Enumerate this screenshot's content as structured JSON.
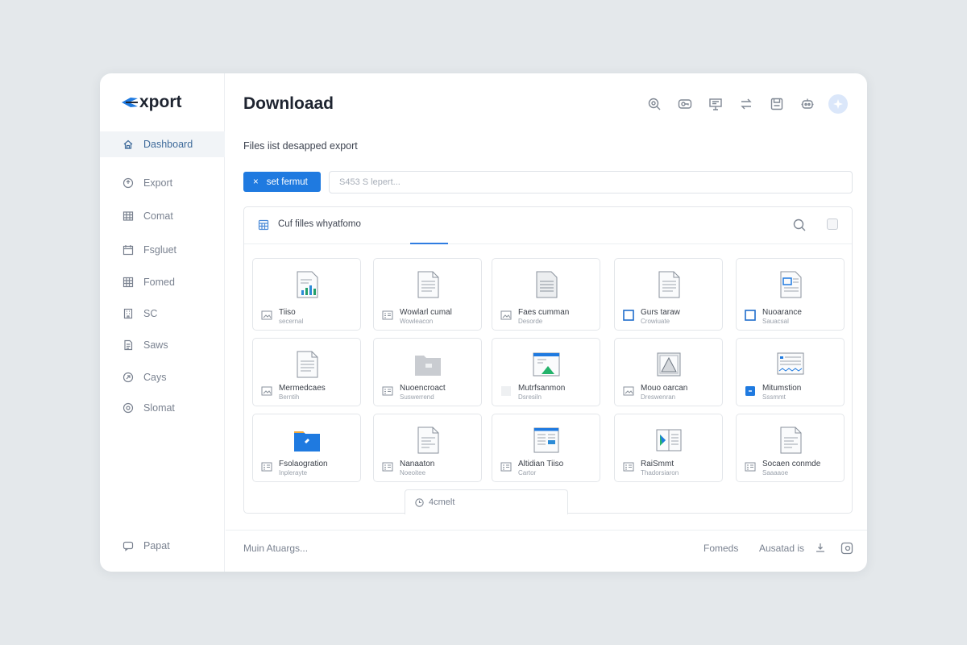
{
  "app": {
    "logo_text": "xport"
  },
  "sidebar": {
    "items": [
      {
        "label": "Dashboard",
        "icon": "home-icon",
        "active": true
      },
      {
        "label": "Export",
        "icon": "export-icon"
      },
      {
        "label": "Comat",
        "icon": "table-icon"
      },
      {
        "label": "Fsgluet",
        "icon": "calendar-icon"
      },
      {
        "label": "Fomed",
        "icon": "grid-icon"
      },
      {
        "label": "SC",
        "icon": "building-icon"
      },
      {
        "label": "Saws",
        "icon": "document-icon"
      },
      {
        "label": "Cays",
        "icon": "tag-icon"
      },
      {
        "label": "Slomat",
        "icon": "settings-icon"
      }
    ],
    "bottom_item": {
      "label": "Papat",
      "icon": "chat-icon"
    }
  },
  "header": {
    "title": "Downloaad",
    "icons": [
      "search-zoom-icon",
      "key-icon",
      "presentation-icon",
      "swap-icon",
      "save-icon",
      "robot-icon",
      "profile-icon"
    ]
  },
  "main": {
    "subtitle": "Files iist desapped export",
    "format_button": {
      "icon": "×",
      "label": "set fermut"
    },
    "search": {
      "placeholder": "S453 S lepert..."
    }
  },
  "panel": {
    "title": "Cuf filles whyatfomo",
    "files": [
      {
        "name": "Tiiso",
        "sub": "secernal"
      },
      {
        "name": "Wowlarl cumal",
        "sub": "Wowleacon"
      },
      {
        "name": "Faes cumman",
        "sub": "Desorde"
      },
      {
        "name": "Gurs taraw",
        "sub": "Crowiuate"
      },
      {
        "name": "Nuoarance",
        "sub": "Sauacsal"
      },
      {
        "name": "Mermedcaes",
        "sub": "Berntih"
      },
      {
        "name": "Nuoencroact",
        "sub": "Suswerrend"
      },
      {
        "name": "Mutrfsanmon",
        "sub": "Dsresiln"
      },
      {
        "name": "Mouo oarcan",
        "sub": "Dreswenran"
      },
      {
        "name": "Mitumstion",
        "sub": "Sssmmt"
      },
      {
        "name": "Fsolaogration",
        "sub": "Inplerayte"
      },
      {
        "name": "Nanaaton",
        "sub": "Noeoitee"
      },
      {
        "name": "Altidian Tiiso",
        "sub": "Cartor"
      },
      {
        "name": "RaiSmmt",
        "sub": "Thadorsiaron"
      },
      {
        "name": "Socaen conmde",
        "sub": "Saaaaoe"
      }
    ],
    "more_label": "4cmelt"
  },
  "footer": {
    "left": "Muin Atuargs...",
    "right1": "Fomeds",
    "right2": "Ausatad is"
  },
  "colors": {
    "accent": "#1f7ae0",
    "background": "#e4e8eb"
  }
}
